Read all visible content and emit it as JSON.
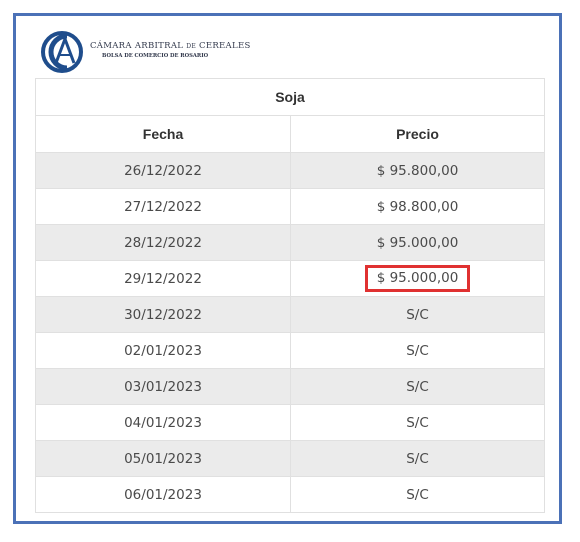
{
  "header": {
    "logo_line1_a": "CÁMARA ARBITRAL",
    "logo_line1_de": "DE",
    "logo_line1_b": "CEREALES",
    "logo_line2": "BOLSA DE COMERCIO DE ROSARIO",
    "logo_color": "#1f4d8c"
  },
  "table": {
    "title": "Soja",
    "columns": [
      "Fecha",
      "Precio"
    ],
    "rows": [
      {
        "fecha": "26/12/2022",
        "precio": "$ 95.800,00"
      },
      {
        "fecha": "27/12/2022",
        "precio": "$ 98.800,00"
      },
      {
        "fecha": "28/12/2022",
        "precio": "$ 95.000,00"
      },
      {
        "fecha": "29/12/2022",
        "precio": "$ 95.000,00"
      },
      {
        "fecha": "30/12/2022",
        "precio": "S/C"
      },
      {
        "fecha": "02/01/2023",
        "precio": "S/C"
      },
      {
        "fecha": "03/01/2023",
        "precio": "S/C"
      },
      {
        "fecha": "04/01/2023",
        "precio": "S/C"
      },
      {
        "fecha": "05/01/2023",
        "precio": "S/C"
      },
      {
        "fecha": "06/01/2023",
        "precio": "S/C"
      }
    ],
    "highlight_color": "#e03131",
    "frame_color": "#4b71b7"
  }
}
